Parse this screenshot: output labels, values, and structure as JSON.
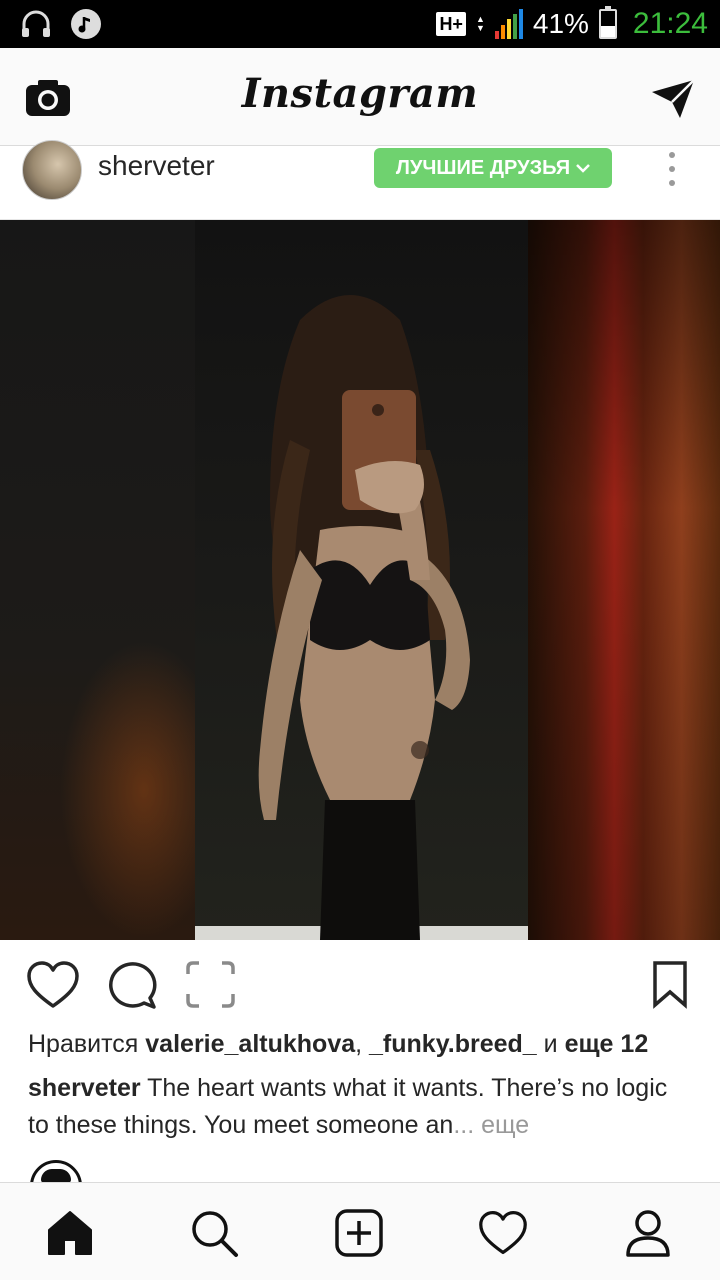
{
  "status_bar": {
    "network_type": "H+",
    "battery_percent": "41%",
    "battery_level": 0.41,
    "time": "21:24",
    "left_icons": [
      "headset-icon",
      "music-note-icon"
    ]
  },
  "header": {
    "title": "Instagram",
    "left_icon": "camera-icon",
    "right_icon": "direct-message-icon"
  },
  "post": {
    "username": "sherveter",
    "audience_badge": "ЛУЧШИЕ ДРУЗЬЯ",
    "badge_color": "#6fd26f",
    "likes": {
      "prefix": "Нравится",
      "user1": "valerie_altukhova",
      "separator": ",",
      "user2": "_funky.breed_",
      "conjunction": "и",
      "more": "еще 12"
    },
    "caption": {
      "author": "sherveter",
      "text": "The heart wants what it wants. There’s no logic to these things. You meet someone an",
      "ellipsis": "...",
      "more": "еще"
    }
  },
  "actions": [
    "heart-icon",
    "comment-icon",
    "share-frame-icon",
    "bookmark-icon"
  ],
  "bottom_nav": [
    "home-icon",
    "search-icon",
    "add-post-icon",
    "activity-heart-icon",
    "profile-icon"
  ],
  "colors": {
    "clock": "#3cbd3c",
    "accent_badge": "#6fd26f",
    "text": "#262626"
  }
}
